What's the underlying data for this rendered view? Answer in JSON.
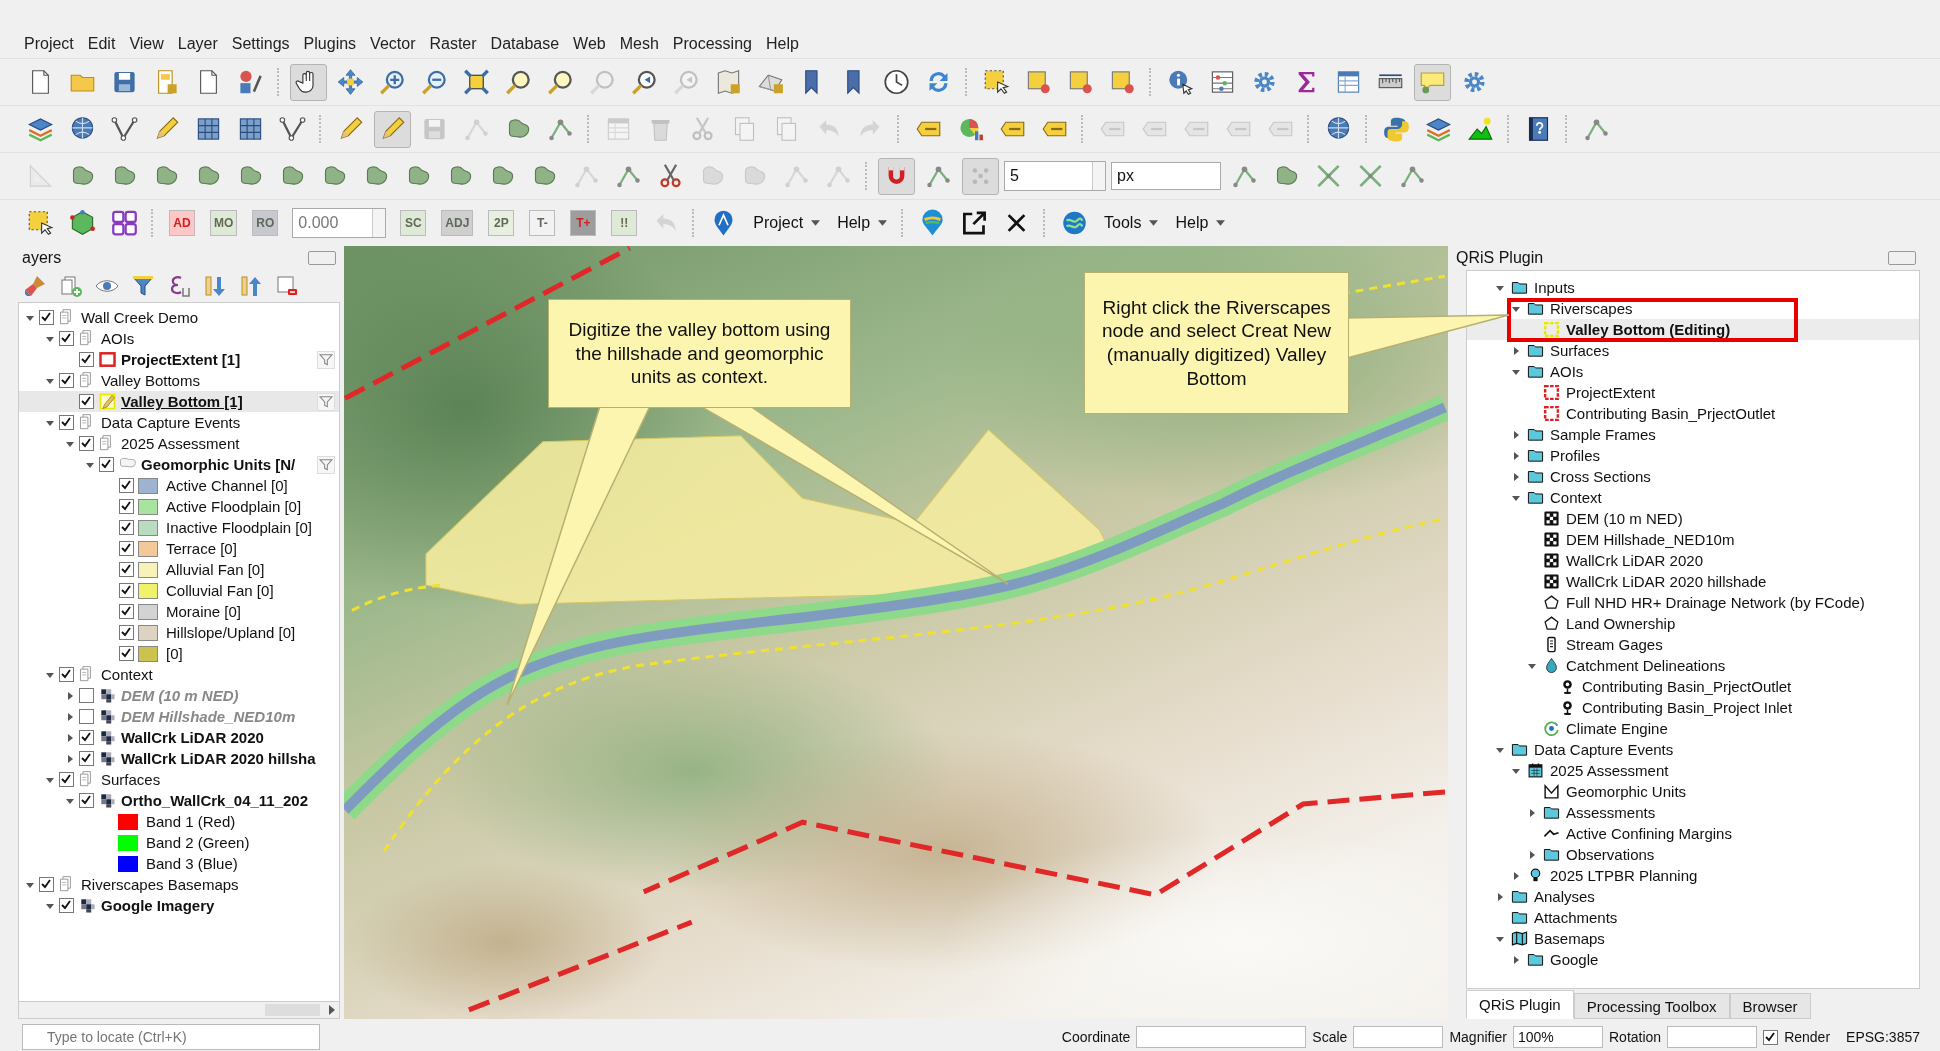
{
  "menu": [
    "Project",
    "Edit",
    "View",
    "Layer",
    "Settings",
    "Plugins",
    "Vector",
    "Raster",
    "Database",
    "Web",
    "Mesh",
    "Processing",
    "Help"
  ],
  "toolbars": [
    {
      "tools": [
        {
          "disabled": false,
          "pressed": false
        },
        {
          "disabled": false,
          "pressed": false
        },
        {
          "disabled": false,
          "pressed": false
        },
        {
          "disabled": false,
          "pressed": false
        },
        {
          "disabled": false,
          "pressed": false
        },
        {
          "disabled": false,
          "pressed": false
        },
        {
          "disabled": false,
          "pressed": true
        },
        {
          "disabled": false,
          "pressed": false
        },
        {
          "disabled": false,
          "pressed": false
        },
        {
          "disabled": false,
          "pressed": false
        },
        {
          "disabled": false,
          "pressed": false
        },
        {
          "disabled": false,
          "pressed": false
        },
        {
          "disabled": false,
          "pressed": false
        },
        {
          "disabled": true,
          "pressed": false
        },
        {
          "disabled": false,
          "pressed": false
        },
        {
          "disabled": true,
          "pressed": false
        },
        {
          "disabled": false,
          "pressed": false
        },
        {
          "disabled": false,
          "pressed": false
        },
        {
          "disabled": false,
          "pressed": false
        },
        {
          "disabled": false,
          "pressed": false
        },
        {
          "disabled": false,
          "pressed": false
        },
        {
          "disabled": false,
          "pressed": false
        },
        {
          "disabled": false,
          "pressed": false
        },
        {
          "disabled": false,
          "pressed": false
        },
        {
          "disabled": false,
          "pressed": false
        },
        {
          "disabled": false,
          "pressed": false
        },
        {
          "disabled": false,
          "pressed": false
        },
        {
          "disabled": false,
          "pressed": false
        },
        {
          "disabled": false,
          "pressed": false
        },
        {
          "disabled": false,
          "pressed": false
        },
        {
          "disabled": false,
          "pressed": false
        },
        {
          "disabled": false,
          "pressed": false
        },
        {
          "disabled": false,
          "pressed": true
        },
        {
          "disabled": false,
          "pressed": false
        }
      ]
    },
    {
      "tools": [
        {
          "disabled": false,
          "pressed": false
        },
        {
          "disabled": false,
          "pressed": false
        },
        {
          "disabled": false,
          "pressed": false
        },
        {
          "disabled": false,
          "pressed": false
        },
        {
          "disabled": false,
          "pressed": false
        },
        {
          "disabled": false,
          "pressed": false
        },
        {
          "disabled": false,
          "pressed": false
        },
        {
          "disabled": false,
          "pressed": false
        },
        {
          "disabled": false,
          "pressed": true
        },
        {
          "disabled": true,
          "pressed": false
        },
        {
          "disabled": true,
          "pressed": false
        },
        {
          "disabled": false,
          "pressed": false
        },
        {
          "disabled": false,
          "pressed": false
        },
        {
          "disabled": true,
          "pressed": false
        },
        {
          "disabled": true,
          "pressed": false
        },
        {
          "disabled": true,
          "pressed": false
        },
        {
          "disabled": true,
          "pressed": false
        },
        {
          "disabled": true,
          "pressed": false
        },
        {
          "disabled": true,
          "pressed": false
        },
        {
          "disabled": true,
          "pressed": false
        },
        {
          "disabled": false,
          "pressed": false
        },
        {
          "disabled": false,
          "pressed": false
        },
        {
          "disabled": false,
          "pressed": false
        },
        {
          "disabled": false,
          "pressed": false
        },
        {
          "disabled": true,
          "pressed": false
        },
        {
          "disabled": true,
          "pressed": false
        },
        {
          "disabled": true,
          "pressed": false
        },
        {
          "disabled": true,
          "pressed": false
        },
        {
          "disabled": true,
          "pressed": false
        },
        {
          "disabled": false,
          "pressed": false
        },
        {
          "disabled": false,
          "pressed": false
        },
        {
          "disabled": false,
          "pressed": false
        },
        {
          "disabled": false,
          "pressed": false
        },
        {
          "disabled": false,
          "pressed": false
        },
        {
          "disabled": false,
          "pressed": false
        }
      ]
    },
    {
      "tools": [
        {
          "disabled": true,
          "pressed": false
        },
        {
          "disabled": false,
          "pressed": false
        },
        {
          "disabled": false,
          "pressed": false
        },
        {
          "disabled": false,
          "pressed": false
        },
        {
          "disabled": false,
          "pressed": false
        },
        {
          "disabled": false,
          "pressed": false
        },
        {
          "disabled": false,
          "pressed": false
        },
        {
          "disabled": false,
          "pressed": false
        },
        {
          "disabled": false,
          "pressed": false
        },
        {
          "disabled": false,
          "pressed": false
        },
        {
          "disabled": false,
          "pressed": false
        },
        {
          "disabled": false,
          "pressed": false
        },
        {
          "disabled": false,
          "pressed": false
        },
        {
          "disabled": true,
          "pressed": false
        },
        {
          "disabled": false,
          "pressed": false
        },
        {
          "disabled": false,
          "pressed": false
        },
        {
          "disabled": true,
          "pressed": false
        },
        {
          "disabled": true,
          "pressed": false
        },
        {
          "disabled": true,
          "pressed": false
        },
        {
          "disabled": true,
          "pressed": false
        },
        {
          "disabled": false,
          "pressed": true
        },
        {
          "disabled": false,
          "pressed": false
        },
        {
          "disabled": true,
          "pressed": true
        },
        {
          "disabled": false,
          "pressed": false
        },
        {
          "disabled": false,
          "pressed": false
        },
        {
          "disabled": false,
          "pressed": false
        },
        {
          "disabled": false,
          "pressed": false
        },
        {
          "disabled": false,
          "pressed": false
        }
      ]
    }
  ],
  "snapping": {
    "tolerance": "5",
    "units": "px"
  },
  "cad_toolbar": {
    "buttons_left": [
      {
        "label": "AD",
        "disabled": false,
        "color": "#ffc8c8"
      },
      {
        "label": "MO",
        "disabled": true,
        "color": "#dfe9d8"
      },
      {
        "label": "RO",
        "disabled": true,
        "color": "#c8c8d0"
      }
    ],
    "value": "0.000",
    "buttons_right": [
      {
        "label": "SC",
        "disabled": true,
        "color": "#dfe9d8"
      },
      {
        "label": "ADJ",
        "disabled": true,
        "color": "#cfcfcf"
      },
      {
        "label": "2P",
        "disabled": true,
        "color": "#e6efe0"
      },
      {
        "label": "T-",
        "disabled": true,
        "color": "#f2f2f2"
      },
      {
        "label": "T+",
        "disabled": false,
        "color": "#9d9d9d"
      },
      {
        "label": "!!",
        "disabled": true,
        "color": "#dfe9d8"
      }
    ]
  },
  "plugin_menus": [
    {
      "items": [
        "Project",
        "Help"
      ]
    },
    {
      "items": [
        "Tools",
        "Help"
      ]
    }
  ],
  "layers_panel": {
    "title": "ayers"
  },
  "layers_tree": [
    {
      "label": "Wall Creek Demo",
      "kind": "group",
      "checked": true,
      "expanded": true,
      "selected": false,
      "children": [
        {
          "label": "AOIs",
          "kind": "group",
          "checked": true,
          "expanded": true,
          "selected": false,
          "children": [
            {
              "label": "ProjectExtent [1]",
              "kind": "polygon",
              "checked": true,
              "selected": false,
              "editing": false,
              "filter": true
            }
          ]
        },
        {
          "label": "Valley Bottoms",
          "kind": "group",
          "checked": true,
          "expanded": true,
          "selected": false,
          "children": [
            {
              "label": "Valley Bottom [1]",
              "kind": "polygon",
              "checked": true,
              "selected": true,
              "editing": true,
              "filter": true
            }
          ]
        },
        {
          "label": "Data Capture Events",
          "kind": "group",
          "checked": true,
          "expanded": true,
          "selected": false,
          "children": [
            {
              "label": "2025 Assessment",
              "kind": "group",
              "checked": true,
              "expanded": true,
              "selected": false,
              "children": [
                {
                  "label": "Geomorphic Units [N/",
                  "kind": "categorized",
                  "checked": true,
                  "expanded": true,
                  "selected": false,
                  "editing": false,
                  "filter": true,
                  "children": [
                    {
                      "label": "Active Channel [0]",
                      "kind": "class",
                      "checked": true,
                      "selected": false,
                      "color": "#9db3cf"
                    },
                    {
                      "label": "Active Floodplain [0]",
                      "kind": "class",
                      "checked": true,
                      "selected": false,
                      "color": "#a8e4a0"
                    },
                    {
                      "label": "Inactive Floodplain [0]",
                      "kind": "class",
                      "checked": true,
                      "selected": false,
                      "color": "#b9dcc0"
                    },
                    {
                      "label": "Terrace [0]",
                      "kind": "class",
                      "checked": true,
                      "selected": false,
                      "color": "#f5c89a"
                    },
                    {
                      "label": "Alluvial Fan [0]",
                      "kind": "class",
                      "checked": true,
                      "selected": false,
                      "color": "#f7f3b8"
                    },
                    {
                      "label": "Colluvial Fan [0]",
                      "kind": "class",
                      "checked": true,
                      "selected": false,
                      "color": "#f0f36a"
                    },
                    {
                      "label": "Moraine [0]",
                      "kind": "class",
                      "checked": true,
                      "selected": false,
                      "color": "#d3d3d3"
                    },
                    {
                      "label": "Hillslope/Upland [0]",
                      "kind": "class",
                      "checked": true,
                      "selected": false,
                      "color": "#ddd3c0"
                    },
                    {
                      "label": "[0]",
                      "kind": "class",
                      "checked": true,
                      "selected": false,
                      "color": "#cbc34e"
                    }
                  ]
                }
              ]
            }
          ]
        },
        {
          "label": "Context",
          "kind": "group",
          "checked": true,
          "expanded": true,
          "selected": false,
          "children": [
            {
              "label": "DEM (10 m NED)",
              "kind": "raster",
              "checked": false,
              "expanded": false,
              "selected": false
            },
            {
              "label": "DEM Hillshade_NED10m",
              "kind": "raster",
              "checked": false,
              "expanded": false,
              "selected": false
            },
            {
              "label": "WallCrk LiDAR 2020",
              "kind": "raster",
              "checked": true,
              "expanded": false,
              "selected": false
            },
            {
              "label": "WallCrk LiDAR 2020 hillsha",
              "kind": "raster",
              "checked": true,
              "expanded": false,
              "selected": false
            }
          ]
        },
        {
          "label": "Surfaces",
          "kind": "group",
          "checked": true,
          "expanded": true,
          "selected": false,
          "children": [
            {
              "label": "Ortho_WallCrk_04_11_202",
              "kind": "raster",
              "checked": true,
              "expanded": true,
              "selected": false,
              "children": [
                {
                  "label": "Band 1 (Red)",
                  "kind": "band",
                  "selected": false,
                  "color": "#ff0000"
                },
                {
                  "label": "Band 2 (Green)",
                  "kind": "band",
                  "selected": false,
                  "color": "#00ff00"
                },
                {
                  "label": "Band 3 (Blue)",
                  "kind": "band",
                  "selected": false,
                  "color": "#0000ff"
                }
              ]
            }
          ]
        }
      ]
    },
    {
      "label": "Riverscapes Basemaps",
      "kind": "group",
      "checked": true,
      "expanded": true,
      "selected": false,
      "children": [
        {
          "label": "Google Imagery",
          "kind": "raster",
          "checked": true,
          "expanded": true,
          "selected": false
        }
      ]
    }
  ],
  "map_callouts": [
    "Digitize the valley bottom using the hillshade and geomorphic units as context.",
    "Right click the Riverscapes node and select Creat New (manually digitized) Valley Bottom"
  ],
  "qris_panel": {
    "title": "QRiS Plugin"
  },
  "qris_tree": [
    {
      "label": "Inputs",
      "kind": "folder",
      "expanded": true,
      "selected": false,
      "children": [
        {
          "label": "Riverscapes",
          "kind": "folder",
          "expanded": true,
          "selected": false,
          "children": [
            {
              "label": "Valley Bottom (Editing)",
              "kind": "polygon",
              "color": "#e8e800",
              "selected": true
            }
          ]
        },
        {
          "label": "Surfaces",
          "kind": "folder",
          "expanded": false,
          "selected": false
        },
        {
          "label": "AOIs",
          "kind": "folder",
          "expanded": true,
          "selected": false,
          "children": [
            {
              "label": "ProjectExtent",
              "kind": "polygon",
              "color": "#e02020",
              "selected": false
            },
            {
              "label": "Contributing Basin_PrjectOutlet",
              "kind": "polygon",
              "color": "#e02020",
              "selected": false
            }
          ]
        },
        {
          "label": "Sample Frames",
          "kind": "folder",
          "expanded": false,
          "selected": false
        },
        {
          "label": "Profiles",
          "kind": "folder",
          "expanded": false,
          "selected": false
        },
        {
          "label": "Cross Sections",
          "kind": "folder",
          "expanded": false,
          "selected": false
        },
        {
          "label": "Context",
          "kind": "folder",
          "expanded": true,
          "selected": false,
          "children": [
            {
              "label": "DEM (10 m NED)",
              "kind": "raster",
              "selected": false
            },
            {
              "label": "DEM Hillshade_NED10m",
              "kind": "raster",
              "selected": false
            },
            {
              "label": "WallCrk LiDAR 2020",
              "kind": "raster",
              "selected": false
            },
            {
              "label": "WallCrk LiDAR 2020 hillshade",
              "kind": "raster",
              "selected": false
            },
            {
              "label": "Full NHD HR+ Drainage Network (by FCode)",
              "kind": "vector",
              "selected": false
            },
            {
              "label": "Land Ownership",
              "kind": "vector",
              "selected": false
            },
            {
              "label": "Stream Gages",
              "kind": "gage",
              "selected": false
            },
            {
              "label": "Catchment Delineations",
              "kind": "drop",
              "expanded": true,
              "selected": false,
              "children": [
                {
                  "label": "Contributing Basin_PrjectOutlet",
                  "kind": "pin",
                  "selected": false
                },
                {
                  "label": "Contributing Basin_Project Inlet",
                  "kind": "pin",
                  "selected": false
                }
              ]
            },
            {
              "label": "Climate Engine",
              "kind": "climate",
              "selected": false
            }
          ]
        }
      ]
    },
    {
      "label": "Data Capture Events",
      "kind": "folder",
      "expanded": true,
      "selected": false,
      "children": [
        {
          "label": "2025 Assessment",
          "kind": "calendar",
          "expanded": true,
          "selected": false,
          "children": [
            {
              "label": "Geomorphic Units",
              "kind": "geomorph",
              "selected": false
            },
            {
              "label": "Assessments",
              "kind": "folder",
              "expanded": false,
              "selected": false
            },
            {
              "label": "Active Confining Margins",
              "kind": "line",
              "selected": false
            },
            {
              "label": "Observations",
              "kind": "folder",
              "expanded": false,
              "selected": false
            }
          ]
        },
        {
          "label": "2025 LTPBR Planning",
          "kind": "bulb",
          "expanded": false,
          "selected": false
        }
      ]
    },
    {
      "label": "Analyses",
      "kind": "folder",
      "expanded": false,
      "selected": false
    },
    {
      "label": "Attachments",
      "kind": "folder",
      "selected": false
    },
    {
      "label": "Basemaps",
      "kind": "map",
      "expanded": true,
      "selected": false,
      "children": [
        {
          "label": "Google",
          "kind": "folder",
          "expanded": false,
          "selected": false
        }
      ]
    }
  ],
  "dock_tabs": [
    {
      "label": "QRiS Plugin",
      "selected": true
    },
    {
      "label": "Processing Toolbox",
      "selected": false
    },
    {
      "label": "Browser",
      "selected": false
    }
  ],
  "status_bar": {
    "locator_placeholder": "Type to locate (Ctrl+K)",
    "coordinate_label": "Coordinate",
    "scale_label": "Scale",
    "magnifier_label": "Magnifier",
    "magnifier_value": "100%",
    "rotation_label": "Rotation",
    "render_label": "Render",
    "render_checked": true,
    "crs": "EPSG:3857"
  }
}
